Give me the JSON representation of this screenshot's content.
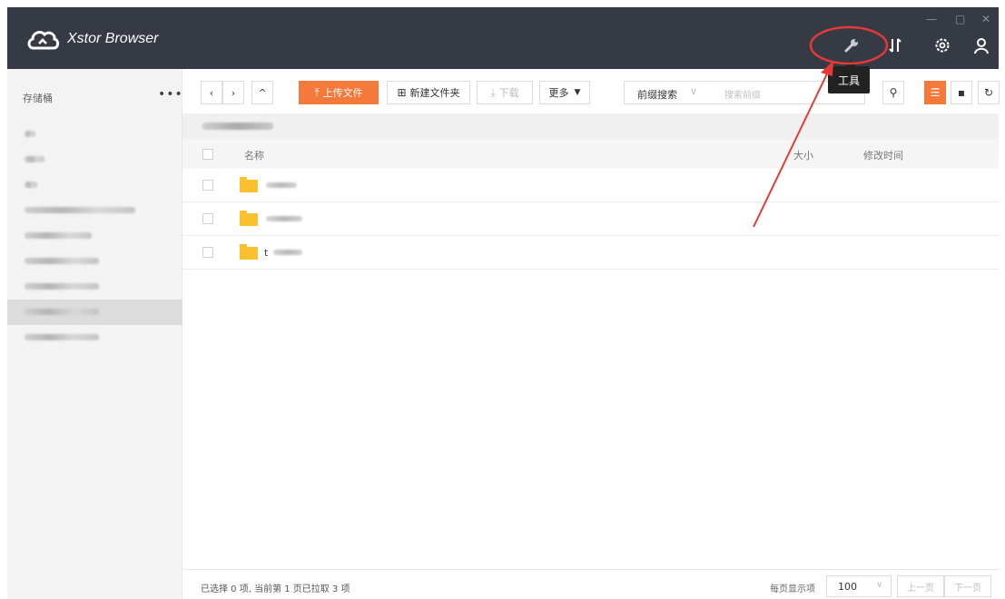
{
  "app": {
    "title": "Xstor Browser",
    "window_controls": [
      "—",
      "□",
      "✕"
    ]
  },
  "header_icons": [
    "wrench-icon",
    "transfer-icon",
    "gear-icon",
    "user-icon"
  ],
  "tooltip": {
    "label": "工具"
  },
  "sidebar": {
    "title": "存储桶",
    "more": "•••",
    "buckets_count_visible": 9,
    "selected_index": 7
  },
  "toolbar": {
    "nav": {
      "back": "‹",
      "forward": "›",
      "up": "^"
    },
    "upload_label": "上传文件",
    "new_folder_label": "新建文件夹",
    "download_label": "下载",
    "more_label": "更多",
    "search": {
      "mode": "前缀搜索",
      "placeholder": "搜索前缀"
    }
  },
  "table": {
    "columns": [
      "名称",
      "大小",
      "修改时间"
    ],
    "rows": [
      {
        "name": ""
      },
      {
        "name": ""
      },
      {
        "name": "t"
      }
    ]
  },
  "footer": {
    "status": "已选择 0 项, 当前第 1 页已拉取 3 项",
    "page_size_label": "每页显示项",
    "page_size": "100",
    "prev": "上一页",
    "next": "下一页"
  },
  "colors": {
    "header_bg": "#353a45",
    "accent": "#f5793b",
    "folder": "#fbc02d",
    "annotation": "#e53935"
  }
}
